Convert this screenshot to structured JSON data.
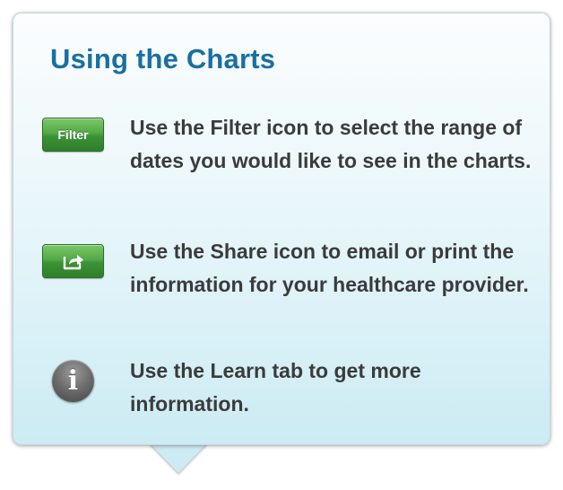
{
  "tooltip": {
    "title": "Using the Charts",
    "items": [
      {
        "icon": "filter-button",
        "button_label": "Filter",
        "text": "Use the Filter icon to select the range of dates you would like to see in the charts."
      },
      {
        "icon": "share-icon",
        "text": "Use the Share icon to email or print the information for your healthcare provider."
      },
      {
        "icon": "info-icon",
        "glyph": "i",
        "text": "Use the Learn tab to get more information."
      }
    ]
  },
  "colors": {
    "title": "#1a6fa1",
    "body_text": "#3b3b3b",
    "button_green": "#3c9236",
    "card_top": "#fbfdfe",
    "card_bottom": "#ccebf3",
    "info_gray": "#6b6b6b"
  }
}
